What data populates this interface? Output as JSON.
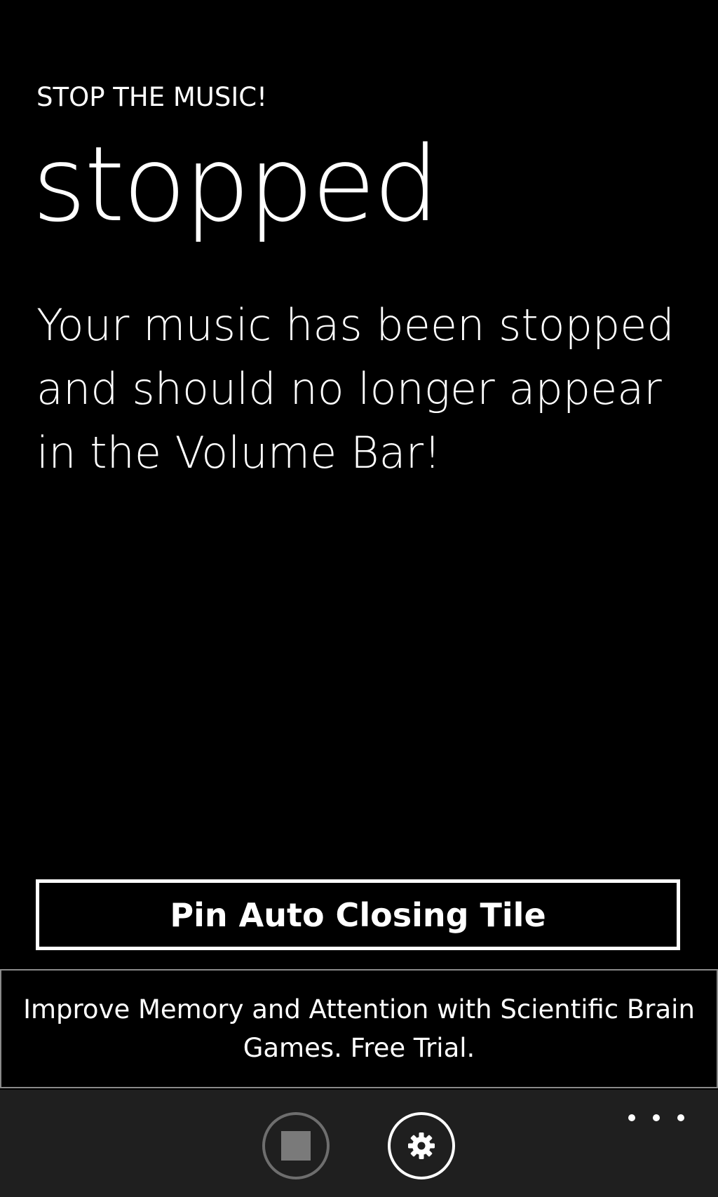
{
  "header": {
    "app_title": "STOP THE MUSIC!",
    "page_title": "stopped"
  },
  "main": {
    "message": "Your music has been stopped and should no longer appear in the Volume Bar!",
    "pin_button_label": "Pin Auto Closing Tile"
  },
  "ad": {
    "text": "Improve Memory and Attention with Scientific Brain Games. Free Trial."
  },
  "app_bar": {
    "buttons": [
      {
        "icon": "stop-icon",
        "state": "disabled"
      },
      {
        "icon": "gear-icon",
        "state": "enabled"
      }
    ],
    "more_icon": "more-ellipsis-icon"
  },
  "colors": {
    "background": "#000000",
    "foreground": "#ffffff",
    "app_bar_background": "#1f1f1f",
    "disabled": "#7a7a7a"
  }
}
